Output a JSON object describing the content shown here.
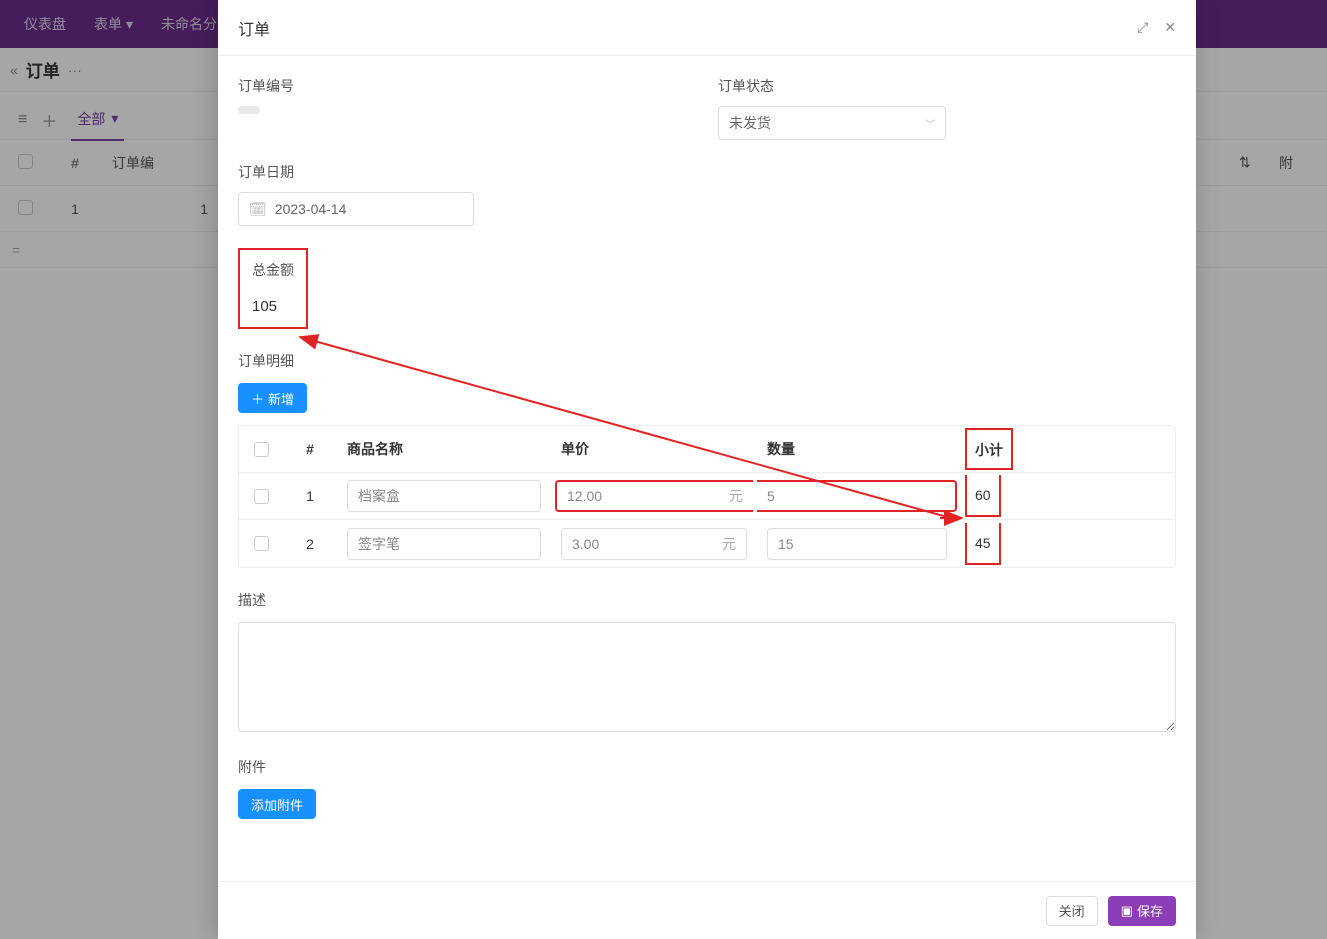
{
  "nav": {
    "dashboard": "仪表盘",
    "form": "表单",
    "unnamed": "未命名分"
  },
  "breadcrumb": {
    "title": "订单",
    "more": "···"
  },
  "view_tabs": {
    "active": "全部"
  },
  "bg_table": {
    "headers": {
      "index": "#",
      "order_no": "订单编",
      "attach": "附"
    },
    "rows": [
      {
        "index": "1",
        "order_no": "1"
      }
    ],
    "equals": "="
  },
  "modal": {
    "title": "订单",
    "fields": {
      "order_no_label": "订单编号",
      "order_status_label": "订单状态",
      "order_status_value": "未发货",
      "order_date_label": "订单日期",
      "order_date_value": "2023-04-14",
      "total_label": "总金额",
      "total_value": "105",
      "detail_label": "订单明细",
      "add_button": "新增",
      "desc_label": "描述",
      "attach_label": "附件",
      "add_attach_button": "添加附件"
    },
    "detail_headers": {
      "index": "#",
      "name": "商品名称",
      "price": "单价",
      "qty": "数量",
      "subtotal": "小计"
    },
    "detail_rows": [
      {
        "index": "1",
        "name": "档案盒",
        "price": "12.00",
        "price_suffix": "元",
        "qty": "5",
        "subtotal": "60"
      },
      {
        "index": "2",
        "name": "签字笔",
        "price": "3.00",
        "price_suffix": "元",
        "qty": "15",
        "subtotal": "45"
      }
    ],
    "footer": {
      "close": "关闭",
      "save": "保存"
    }
  }
}
